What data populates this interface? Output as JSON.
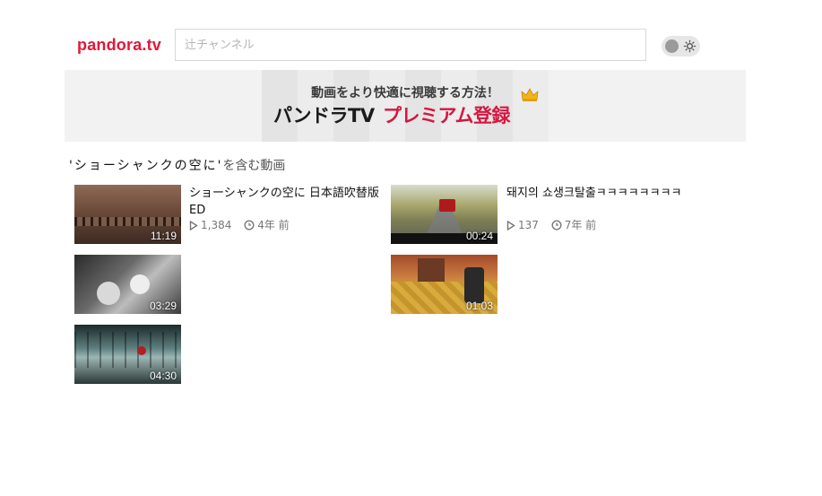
{
  "header": {
    "logo": "pandora.tv",
    "search_placeholder": "辻チャンネル",
    "theme_toggle_icon": "sun-icon"
  },
  "banner": {
    "headline": "動画をより快適に視聴する方法！",
    "brand": "パンドラTV",
    "premium": "プレミアム登録"
  },
  "results": {
    "heading_query": "'ショーシャンクの空に'",
    "heading_suffix": "を含む動画"
  },
  "videos": [
    {
      "title": "ショーシャンクの空に 日本語吹替版ED",
      "duration": "11:19",
      "views": "1,384",
      "age": "4年 前"
    },
    {
      "title": "돼지의 쇼생크탈출ㅋㅋㅋㅋㅋㅋㅋㅋ",
      "duration": "00:24",
      "views": "137",
      "age": "7年 前"
    },
    {
      "title": "",
      "duration": "03:29"
    },
    {
      "title": "",
      "duration": "01:03"
    },
    {
      "title": "",
      "duration": "04:30"
    }
  ],
  "colors": {
    "brand_red": "#e0183a",
    "banner_bg": "#f2f2f2"
  }
}
